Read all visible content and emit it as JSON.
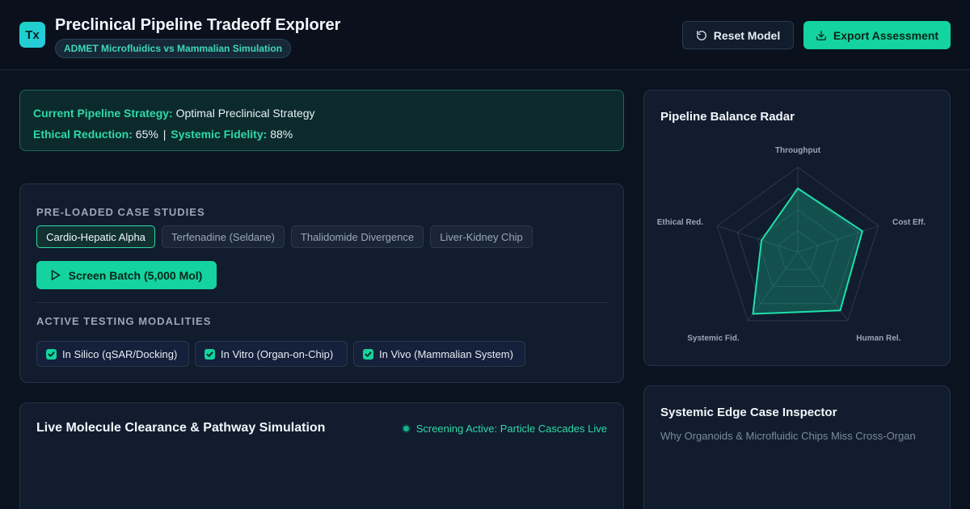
{
  "header": {
    "logo": "Tx",
    "title": "Preclinical Pipeline Tradeoff Explorer",
    "subtitle": "ADMET Microfluidics vs Mammalian Simulation",
    "reset_label": "Reset Model",
    "export_label": "Export Assessment",
    "icons": {
      "reset": "rotate-ccw-icon",
      "export": "download-icon"
    }
  },
  "strategy": {
    "strategy_label": "Current Pipeline Strategy:",
    "strategy_value": "Optimal Preclinical Strategy",
    "ethical_label": "Ethical Reduction:",
    "ethical_value": "65%",
    "separator": "|",
    "fidelity_label": "Systemic Fidelity:",
    "fidelity_value": "88%"
  },
  "case_studies": {
    "heading": "PRE-LOADED CASE STUDIES",
    "items": [
      {
        "label": "Cardio-Hepatic Alpha",
        "active": true
      },
      {
        "label": "Terfenadine (Seldane)",
        "active": false
      },
      {
        "label": "Thalidomide Divergence",
        "active": false
      },
      {
        "label": "Liver-Kidney Chip",
        "active": false
      }
    ],
    "screen_button": "Screen Batch (5,000 Mol)"
  },
  "modalities": {
    "heading": "ACTIVE TESTING MODALITIES",
    "items": [
      {
        "label": "In Silico (qSAR/Docking)",
        "checked": true
      },
      {
        "label": "In Vitro (Organ-on-Chip)",
        "checked": true
      },
      {
        "label": "In Vivo (Mammalian System)",
        "checked": true
      }
    ]
  },
  "simulation": {
    "title": "Live Molecule Clearance & Pathway Simulation",
    "status": "Screening Active: Particle Cascades Live"
  },
  "radar": {
    "title": "Pipeline Balance Radar",
    "axes": [
      "Throughput",
      "Cost Eff.",
      "Human Rel.",
      "Systemic Fid.",
      "Ethical Red."
    ]
  },
  "chart_data": {
    "type": "radar",
    "title": "Pipeline Balance Radar",
    "categories": [
      "Throughput",
      "Cost Eff.",
      "Human Rel.",
      "Systemic Fid.",
      "Ethical Red."
    ],
    "values": [
      0.75,
      0.8,
      0.85,
      0.9,
      0.45
    ],
    "range": [
      0,
      1
    ],
    "rings": 4,
    "colors": {
      "fill": "#14d39e",
      "stroke": "#1fe0aa",
      "grid": "#2c3a4d"
    }
  },
  "edge_inspector": {
    "title": "Systemic Edge Case Inspector",
    "subtitle": "Why Organoids & Microfluidic Chips Miss Cross-Organ"
  },
  "colors": {
    "accent": "#14d39e",
    "background": "#0b1220",
    "card": "#111c2e"
  }
}
